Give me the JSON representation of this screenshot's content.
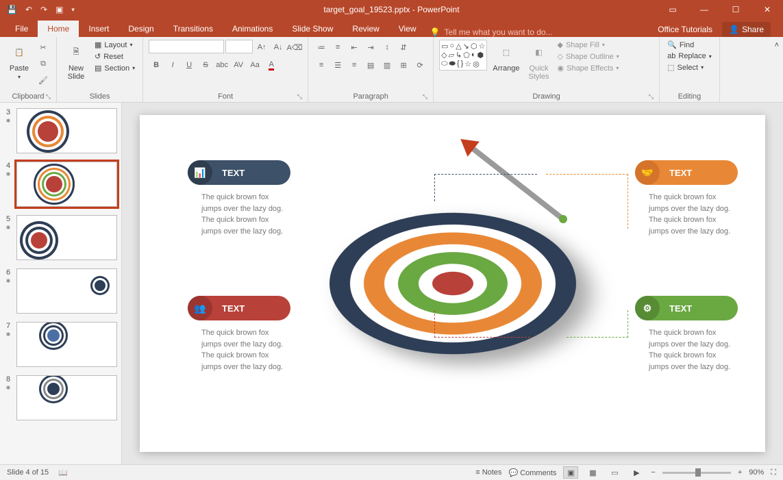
{
  "titlebar": {
    "filename": "target_goal_19523.pptx - PowerPoint"
  },
  "tabs": {
    "file": "File",
    "items": [
      "Home",
      "Insert",
      "Design",
      "Transitions",
      "Animations",
      "Slide Show",
      "Review",
      "View"
    ],
    "tellme": "Tell me what you want to do...",
    "tutorials": "Office Tutorials",
    "share": "Share"
  },
  "ribbon": {
    "clipboard": {
      "paste": "Paste",
      "label": "Clipboard"
    },
    "slides": {
      "newslide": "New\nSlide",
      "layout": "Layout",
      "reset": "Reset",
      "section": "Section",
      "label": "Slides"
    },
    "font": {
      "label": "Font"
    },
    "paragraph": {
      "label": "Paragraph"
    },
    "drawing": {
      "arrange": "Arrange",
      "quick": "Quick\nStyles",
      "fill": "Shape Fill",
      "outline": "Shape Outline",
      "effects": "Shape Effects",
      "label": "Drawing"
    },
    "editing": {
      "find": "Find",
      "replace": "Replace",
      "select": "Select",
      "label": "Editing"
    }
  },
  "thumbs": [
    {
      "n": "3"
    },
    {
      "n": "4",
      "sel": true
    },
    {
      "n": "5"
    },
    {
      "n": "6"
    },
    {
      "n": "7"
    },
    {
      "n": "8"
    }
  ],
  "slide": {
    "callouts": [
      {
        "label": "TEXT",
        "desc": "The quick brown fox jumps over the lazy dog. The quick brown fox jumps over the lazy dog.",
        "color": "#3d5168",
        "ico": "📊"
      },
      {
        "label": "TEXT",
        "desc": "The quick brown fox jumps over the lazy dog. The quick brown fox jumps over the lazy dog.",
        "color": "#b84139",
        "ico": "👥"
      },
      {
        "label": "TEXT",
        "desc": "The quick brown fox jumps over the lazy dog. The quick brown fox jumps over the lazy dog.",
        "color": "#e88836",
        "ico": "🤝"
      },
      {
        "label": "TEXT",
        "desc": "The quick brown fox jumps over the lazy dog. The quick brown fox jumps over the lazy dog.",
        "color": "#6aa842",
        "ico": "⚙"
      }
    ]
  },
  "status": {
    "slide": "Slide 4 of 15",
    "notes": "Notes",
    "comments": "Comments",
    "zoom": "90%"
  }
}
